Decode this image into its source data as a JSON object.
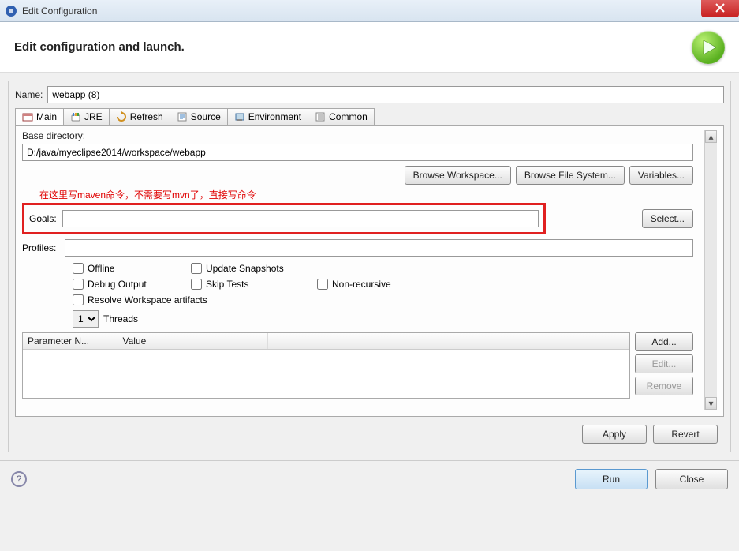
{
  "window": {
    "title": "Edit Configuration"
  },
  "header": {
    "title": "Edit configuration and launch."
  },
  "name": {
    "label": "Name:",
    "value": "webapp (8)"
  },
  "tabs": {
    "main": "Main",
    "jre": "JRE",
    "refresh": "Refresh",
    "source": "Source",
    "environment": "Environment",
    "common": "Common"
  },
  "main_tab": {
    "base_directory_label": "Base directory:",
    "base_directory_value": "D:/java/myeclipse2014/workspace/webapp",
    "browse_workspace": "Browse Workspace...",
    "browse_filesystem": "Browse File System...",
    "variables": "Variables...",
    "red_note": "在这里写maven命令，不需要写mvn了，直接写命令",
    "goals_label": "Goals:",
    "goals_value": "",
    "select": "Select...",
    "profiles_label": "Profiles:",
    "profiles_value": "",
    "checkboxes": {
      "offline": "Offline",
      "update_snapshots": "Update Snapshots",
      "debug_output": "Debug Output",
      "skip_tests": "Skip Tests",
      "non_recursive": "Non-recursive",
      "resolve_workspace": "Resolve Workspace artifacts"
    },
    "threads": {
      "value": "1",
      "label": "Threads"
    },
    "params": {
      "col_name": "Parameter N...",
      "col_value": "Value",
      "add": "Add...",
      "edit": "Edit...",
      "remove": "Remove"
    }
  },
  "footer": {
    "apply": "Apply",
    "revert": "Revert"
  },
  "bottom": {
    "run": "Run",
    "close": "Close"
  }
}
